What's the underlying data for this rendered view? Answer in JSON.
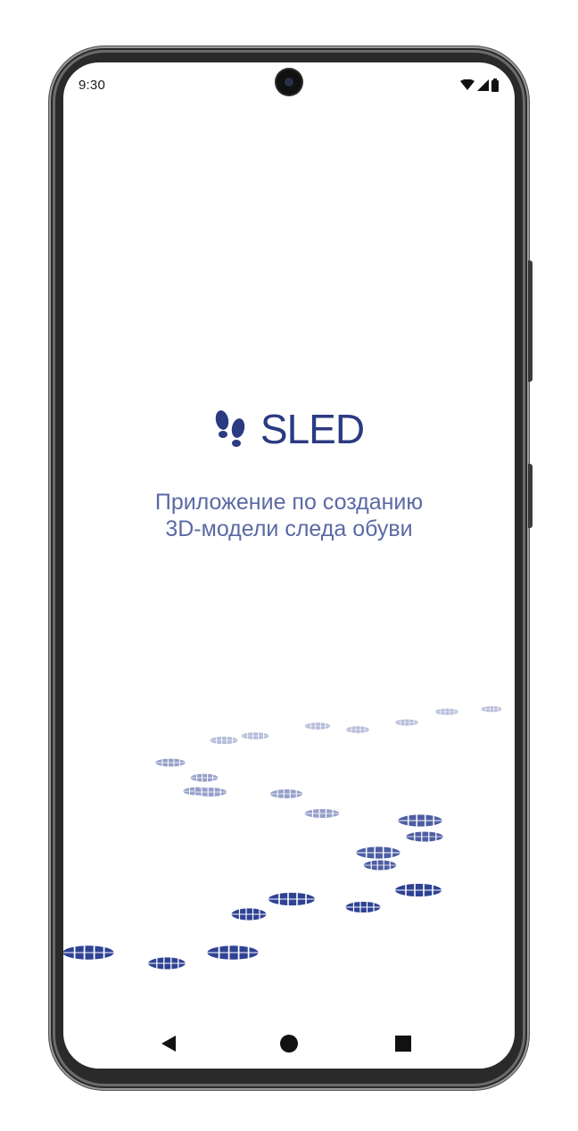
{
  "status_bar": {
    "time": "9:30",
    "icons": [
      "wifi-icon",
      "signal-icon",
      "battery-icon"
    ]
  },
  "app": {
    "logo_text": "SLED",
    "logo_icon": "footprints-icon",
    "tagline_line1": "Приложение по созданию",
    "tagline_line2": "3D-модели следа обуви",
    "brand_color": "#2b3a82",
    "tagline_color": "#5b6aa5"
  },
  "nav_bar": {
    "buttons": [
      "back-icon",
      "home-icon",
      "recents-icon"
    ]
  }
}
